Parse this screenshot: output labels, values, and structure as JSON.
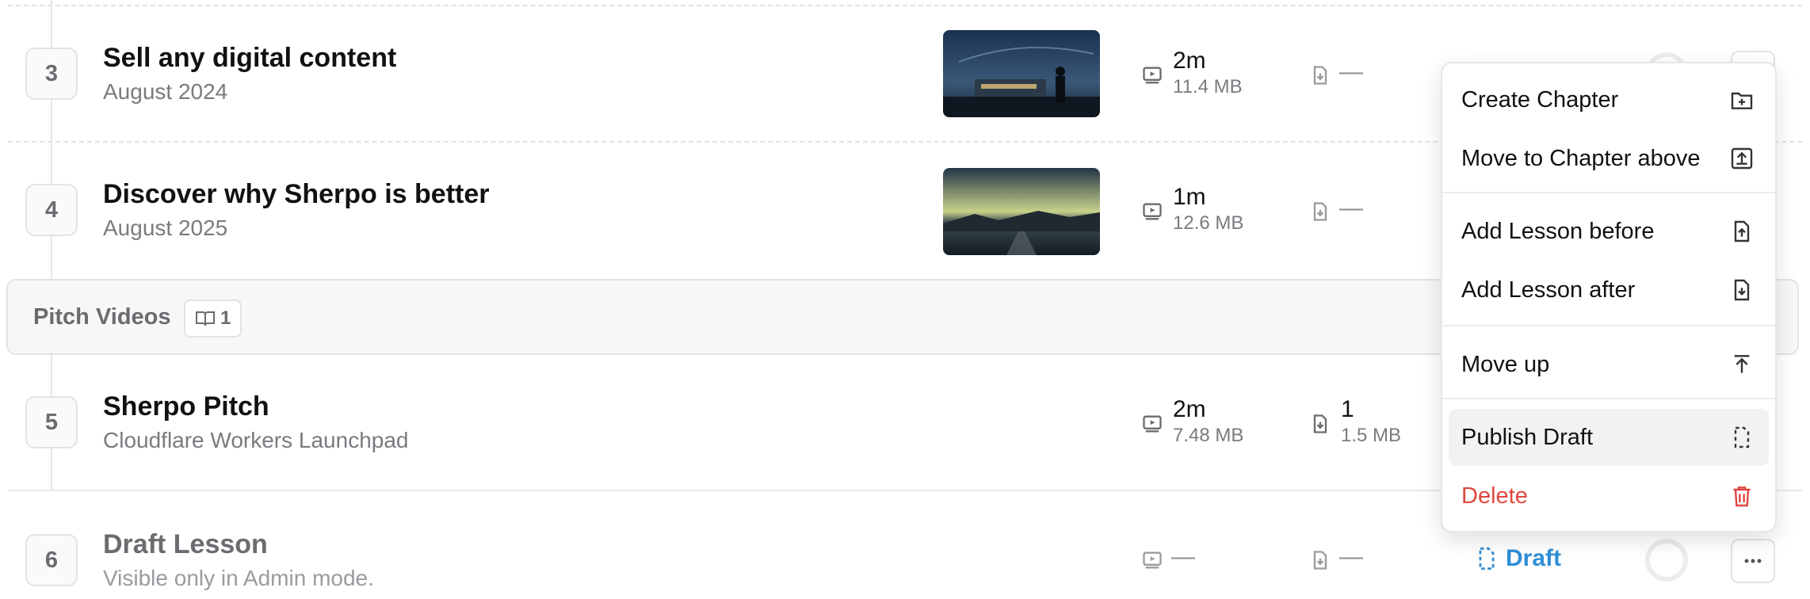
{
  "lessons": [
    {
      "number": "3",
      "title": "Sell any digital content",
      "subtitle": "August 2024",
      "video": {
        "duration": "2m",
        "size": "11.4 MB"
      },
      "attachments": {
        "value": "—"
      }
    },
    {
      "number": "4",
      "title": "Discover why Sherpo is better",
      "subtitle": "August 2025",
      "video": {
        "duration": "1m",
        "size": "12.6 MB"
      },
      "attachments": {
        "value": "—"
      }
    },
    {
      "number": "5",
      "title": "Sherpo Pitch",
      "subtitle": "Cloudflare Workers Launchpad",
      "video": {
        "duration": "2m",
        "size": "7.48 MB"
      },
      "attachments": {
        "count": "1",
        "size": "1.5 MB"
      }
    },
    {
      "number": "6",
      "title": "Draft Lesson",
      "subtitle": "Visible only in Admin mode.",
      "video": {
        "value": "—"
      },
      "attachments": {
        "value": "—"
      },
      "status": "Draft"
    }
  ],
  "chapter": {
    "title": "Pitch Videos",
    "lesson_count": "1"
  },
  "menu": {
    "items": [
      {
        "label": "Create Chapter",
        "icon": "folder-plus-icon"
      },
      {
        "label": "Move to Chapter above",
        "icon": "arrow-up-box-icon"
      },
      {
        "label": "Add Lesson before",
        "icon": "file-arrow-up-icon"
      },
      {
        "label": "Add Lesson after",
        "icon": "file-arrow-down-icon"
      },
      {
        "label": "Move up",
        "icon": "arrow-up-to-line-icon"
      },
      {
        "label": "Publish Draft",
        "icon": "dashed-file-icon"
      },
      {
        "label": "Delete",
        "icon": "trash-icon"
      }
    ]
  },
  "colors": {
    "accent": "#2f8fd6",
    "danger": "#e0483f",
    "muted": "#7a7a80"
  }
}
